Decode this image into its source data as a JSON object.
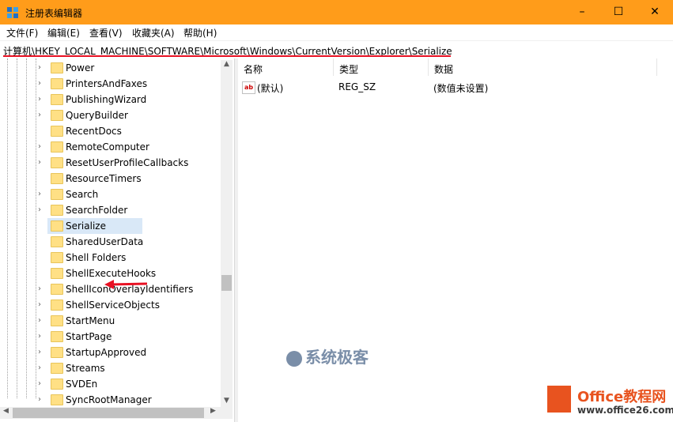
{
  "window": {
    "title": "注册表编辑器",
    "controls": {
      "minimize": "–",
      "maximize": "☐",
      "close": "✕"
    }
  },
  "menu": [
    "文件(F)",
    "编辑(E)",
    "查看(V)",
    "收藏夹(A)",
    "帮助(H)"
  ],
  "address": {
    "path": "计算机\\HKEY_LOCAL_MACHINE\\SOFTWARE\\Microsoft\\Windows\\CurrentVersion\\Explorer\\Serialize"
  },
  "tree": {
    "items": [
      {
        "label": "Power",
        "expandable": true
      },
      {
        "label": "PrintersAndFaxes",
        "expandable": true
      },
      {
        "label": "PublishingWizard",
        "expandable": true
      },
      {
        "label": "QueryBuilder",
        "expandable": true
      },
      {
        "label": "RecentDocs",
        "expandable": false
      },
      {
        "label": "RemoteComputer",
        "expandable": true
      },
      {
        "label": "ResetUserProfileCallbacks",
        "expandable": true
      },
      {
        "label": "ResourceTimers",
        "expandable": false
      },
      {
        "label": "Search",
        "expandable": true
      },
      {
        "label": "SearchFolder",
        "expandable": true
      },
      {
        "label": "Serialize",
        "expandable": false,
        "selected": true
      },
      {
        "label": "SharedUserData",
        "expandable": false
      },
      {
        "label": "Shell Folders",
        "expandable": false
      },
      {
        "label": "ShellExecuteHooks",
        "expandable": false
      },
      {
        "label": "ShellIconOverlayIdentifiers",
        "expandable": true
      },
      {
        "label": "ShellServiceObjects",
        "expandable": true
      },
      {
        "label": "StartMenu",
        "expandable": true
      },
      {
        "label": "StartPage",
        "expandable": true
      },
      {
        "label": "StartupApproved",
        "expandable": true
      },
      {
        "label": "Streams",
        "expandable": true
      },
      {
        "label": "SVDEn",
        "expandable": true
      },
      {
        "label": "SyncRootManager",
        "expandable": true
      }
    ]
  },
  "list": {
    "columns": [
      "名称",
      "类型",
      "数据"
    ],
    "rows": [
      {
        "name": "(默认)",
        "type": "REG_SZ",
        "data": "(数值未设置)",
        "icon": "ab"
      }
    ]
  },
  "watermark": {
    "text": "系统极客"
  },
  "branding": {
    "name": "Office教程网",
    "url": "www.office26.com"
  },
  "colors": {
    "titlebar": "#ff9c1a",
    "selection": "#d9e8f7",
    "annotation": "#e81123",
    "brand": "#e8531f"
  }
}
